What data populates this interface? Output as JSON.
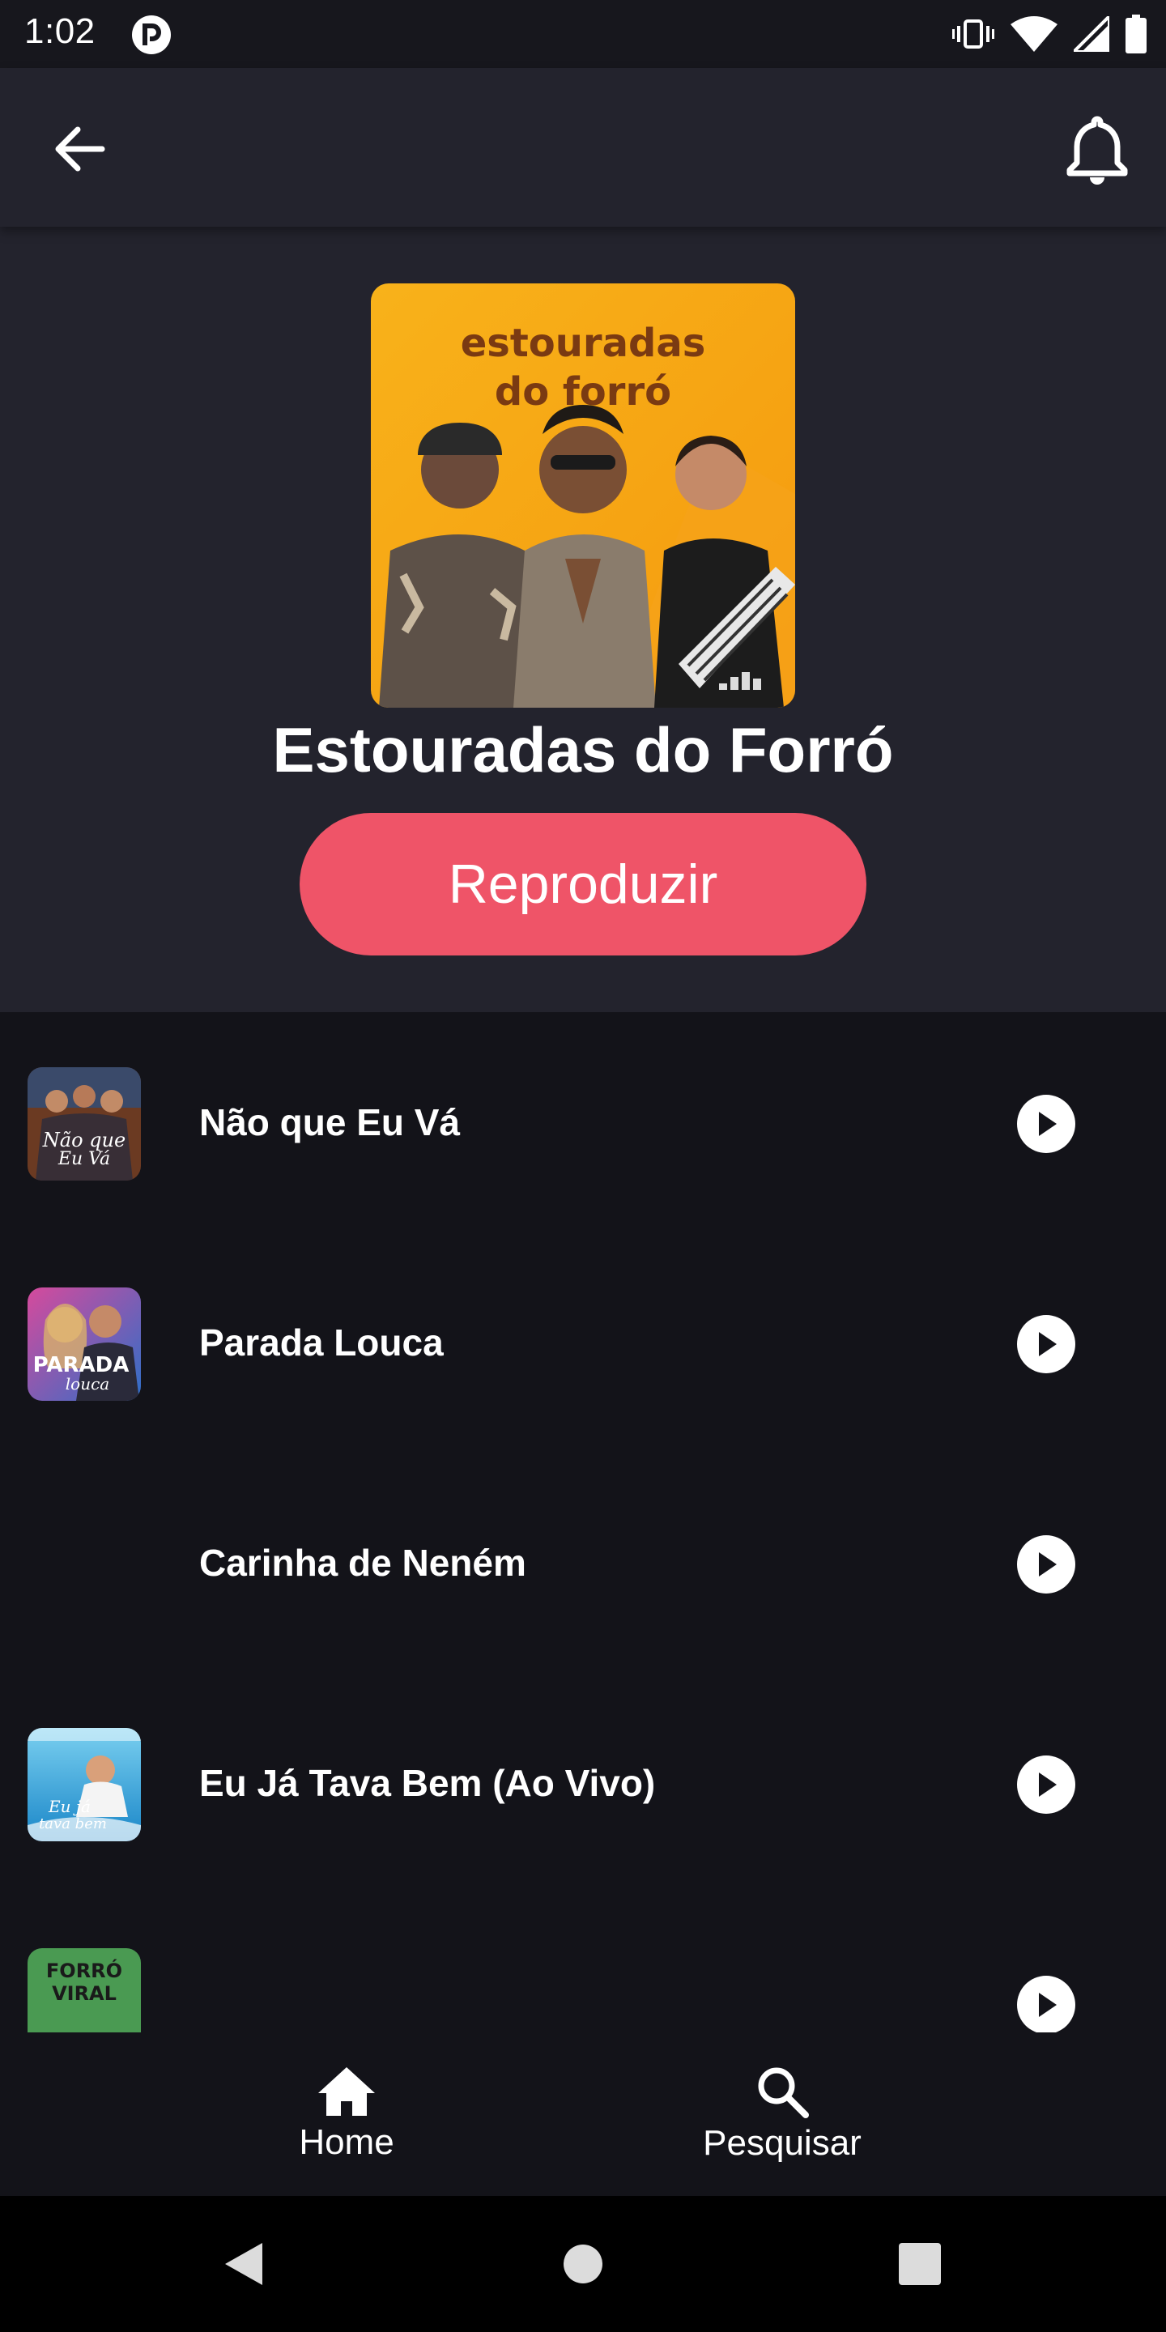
{
  "status_bar": {
    "time": "1:02"
  },
  "app_bar": {
    "back_icon": "arrow-left-icon",
    "notification_icon": "bell-icon"
  },
  "playlist": {
    "cover_text": "estouradas\ndo forró",
    "title": "Estouradas do Forró",
    "play_button_label": "Reproduzir"
  },
  "tracks": [
    {
      "title": "Não que Eu Vá",
      "has_cover": true
    },
    {
      "title": "Parada Louca",
      "has_cover": true
    },
    {
      "title": "Carinha de Neném",
      "has_cover": false
    },
    {
      "title": "Eu Já Tava Bem (Ao Vivo)",
      "has_cover": true
    },
    {
      "title": "",
      "has_cover": true
    }
  ],
  "bottom_nav": {
    "home_label": "Home",
    "search_label": "Pesquisar"
  },
  "colors": {
    "accent": "#ef5468",
    "header_bg": "#23232d",
    "list_bg": "#131319"
  }
}
